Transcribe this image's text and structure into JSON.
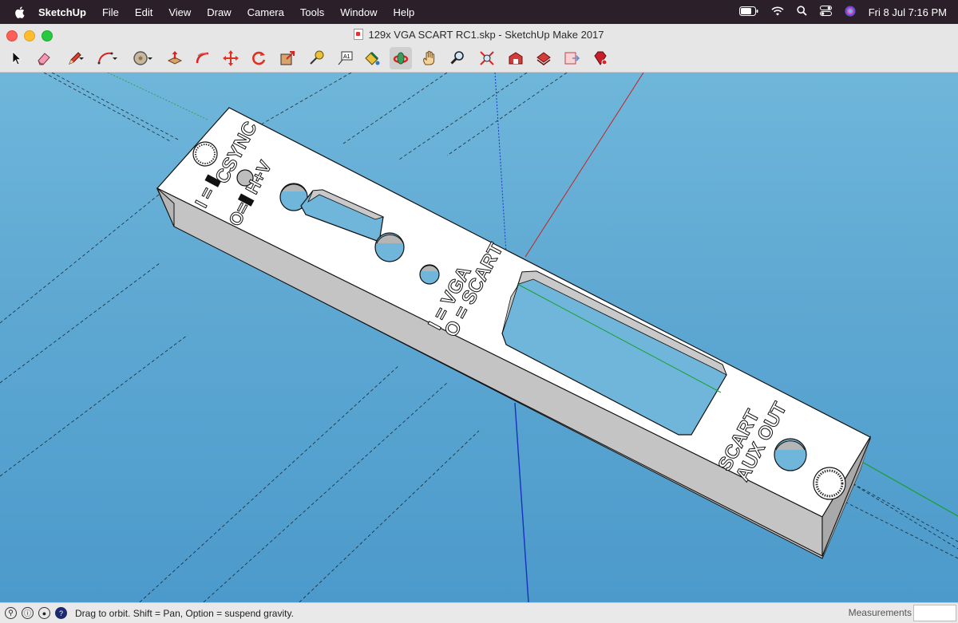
{
  "menubar": {
    "app_name": "SketchUp",
    "items": [
      "File",
      "Edit",
      "View",
      "Draw",
      "Camera",
      "Tools",
      "Window",
      "Help"
    ],
    "clock": "Fri 8 Jul  7:16 PM"
  },
  "window": {
    "title": "129x VGA SCART RC1.skp - SketchUp Make 2017"
  },
  "toolbar": {
    "tools": [
      "select-icon",
      "eraser-icon",
      "pencil-icon",
      "arc-icon",
      "circle-icon",
      "push-pull-icon",
      "follow-me-icon",
      "move-icon",
      "rotate-icon",
      "scale-icon",
      "tape-measure-icon",
      "text-icon",
      "paint-bucket-icon",
      "orbit-icon",
      "pan-icon",
      "zoom-icon",
      "zoom-extents-icon",
      "warehouse-icon",
      "extension-warehouse-icon",
      "layout-icon",
      "ruby-icon"
    ]
  },
  "model": {
    "labels": {
      "csync": "CSYNC",
      "i_eq": "I = ⫴",
      "o_eq": "O=⫴ H+V",
      "i_vga": "I = VGA",
      "o_scart": "O = SCART",
      "scart": "SCART",
      "aux_out": "AUX OUT"
    }
  },
  "status": {
    "hint": "Drag to orbit. Shift = Pan, Option = suspend gravity.",
    "measurements_label": "Measurements"
  }
}
